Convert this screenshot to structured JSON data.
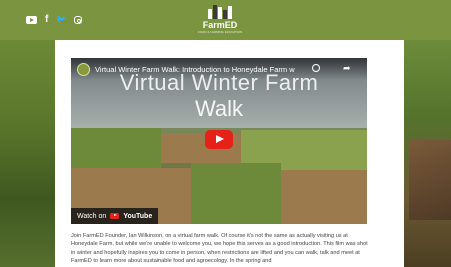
{
  "header": {
    "social_icons": [
      "youtube-icon",
      "facebook-icon",
      "twitter-icon",
      "instagram-icon"
    ],
    "facebook_glyph": "f",
    "twitter_glyph": "🐦",
    "logo": {
      "name": "FarmED",
      "tagline": "FOOD & FARMING EDUCATION"
    },
    "accent_color": "#7a9440"
  },
  "video": {
    "title": "Virtual Winter Farm Walk: Introduction to Honeydale Farm with ...",
    "overlay_title_line1": "Virtual Winter Farm",
    "overlay_title_line2": "Walk",
    "watch_on": "Watch on",
    "youtube": "YouTube",
    "share_glyph": "➦"
  },
  "description": {
    "text": "Join FarmED Founder, Ian Wilkinson, on a virtual farm walk. Of course it's not the same as actually visiting us at Honeydale Farm, but while we're unable to welcome you, we hope this serves as a good introduction. This film was shot in winter and hopefully inspires you to come in person, when restrictions are lifted and you can walk, talk and meet at FarmED to learn more about sustainable food and agroecology. In the spring and"
  }
}
